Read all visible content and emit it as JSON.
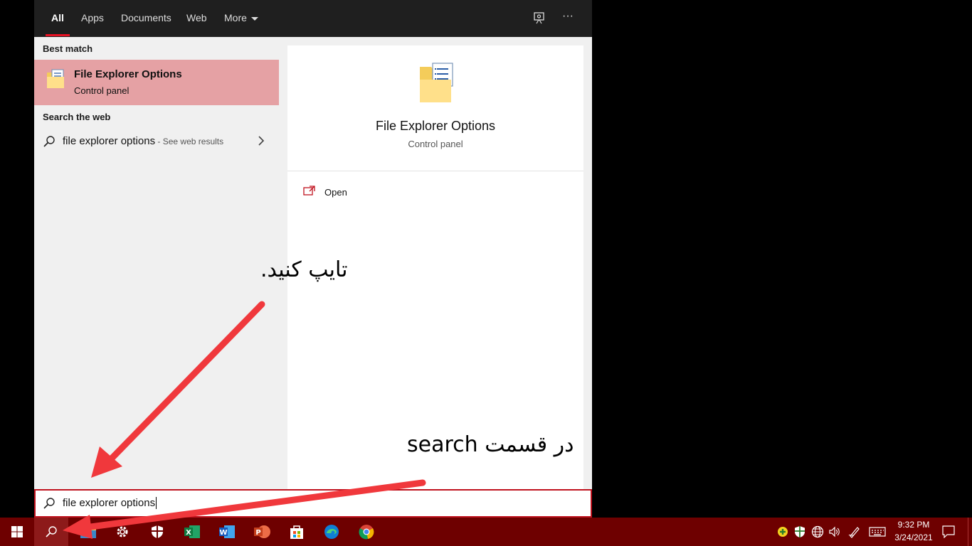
{
  "tabs": [
    {
      "label": "All",
      "active": true
    },
    {
      "label": "Apps"
    },
    {
      "label": "Documents"
    },
    {
      "label": "Web"
    },
    {
      "label": "More"
    }
  ],
  "best_match": {
    "header": "Best match",
    "title": "File Explorer Options",
    "subtitle": "Control panel"
  },
  "web": {
    "header": "Search the web",
    "query": "file explorer options",
    "suffix": " - See web results"
  },
  "detail": {
    "title": "File Explorer Options",
    "subtitle": "Control panel",
    "open_label": "Open"
  },
  "searchbox": {
    "value": "file explorer options"
  },
  "taskbar": {
    "time": "9:32 PM",
    "date": "3/24/2021",
    "apps": [
      "start-icon",
      "search-icon",
      "file-explorer-icon",
      "settings-icon",
      "security-icon",
      "excel-icon",
      "word-icon",
      "powerpoint-icon",
      "store-icon",
      "edge-icon",
      "chrome-icon"
    ]
  },
  "annotations": {
    "top": "تایپ کنید.",
    "bottom": "در قسمت search"
  },
  "colors": {
    "accent": "#e81123",
    "highlight": "#e5a1a4",
    "taskbar": "#6e0000",
    "arrow": "#f0383c"
  }
}
